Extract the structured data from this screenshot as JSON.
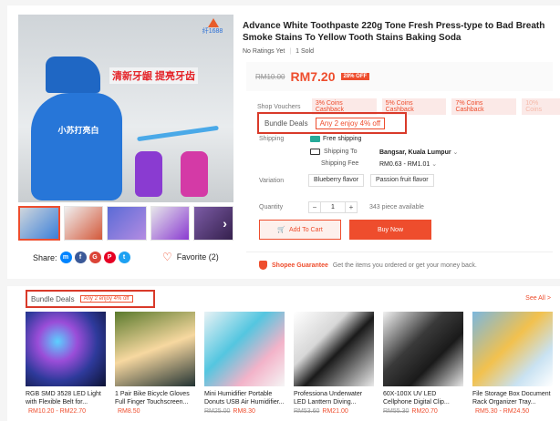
{
  "product": {
    "title": "Advance White Toothpaste 220g Tone Fresh Press-type to Bad Breath Smoke Stains To Yellow Tooth Stains Baking Soda",
    "ratings": "No Ratings Yet",
    "sold": "1 Sold",
    "old_price": "RM10.00",
    "price": "RM7.20",
    "discount": "28% OFF",
    "image_logo_text": "纤1688",
    "image_banner": "清新牙龈 提亮牙齿",
    "image_tube_label": "小苏打亮白"
  },
  "vouchers": {
    "label": "Shop Vouchers",
    "items": [
      "3% Coins Cashback",
      "5% Coins Cashback",
      "7% Coins Cashback",
      "10% Coins"
    ]
  },
  "bundle": {
    "label": "Bundle Deals",
    "tag": "Any 2 enjoy 4% off"
  },
  "shipping": {
    "label": "Shipping",
    "free": "Free shipping",
    "to_label": "Shipping To",
    "to_value": "Bangsar, Kuala Lumpur",
    "fee_label": "Shipping Fee",
    "fee_value": "RM0.63 - RM1.01"
  },
  "variation": {
    "label": "Variation",
    "options": [
      "Blueberry flavor",
      "Passion fruit flavor"
    ]
  },
  "quantity": {
    "label": "Quantity",
    "value": "1",
    "available": "343 piece available"
  },
  "actions": {
    "add_to_cart": "Add To Cart",
    "buy_now": "Buy Now"
  },
  "guarantee": {
    "title": "Shopee Guarantee",
    "text": "Get the items you ordered or get your money back."
  },
  "share": {
    "label": "Share:",
    "favorite": "Favorite (2)"
  },
  "bundle_section": {
    "title": "Bundle Deals",
    "tag": "Any 2 enjoy 4% off",
    "see_all": "See All >",
    "products": [
      {
        "name": "RGB SMD 3528 LED Light with Flexible Belt for...",
        "old": "",
        "price": "RM10.20 - RM22.70"
      },
      {
        "name": "1 Pair Bike Bicycle Gloves Full Finger Touchscreen...",
        "old": "",
        "price": "RM8.50"
      },
      {
        "name": "Mini Humidifier Portable Donuts USB Air Humidifier...",
        "old": "RM25.00",
        "price": "RM8.30"
      },
      {
        "name": "Professiona Underwater LED Lanttern Diving...",
        "old": "RM53.60",
        "price": "RM21.00"
      },
      {
        "name": "60X-100X UV LED Cellphone Digital Clip...",
        "old": "RM55.30",
        "price": "RM20.70"
      },
      {
        "name": "File Storage Box Document Rack Organizer Tray...",
        "old": "",
        "price": "RM5.30 - RM24.50"
      }
    ]
  }
}
